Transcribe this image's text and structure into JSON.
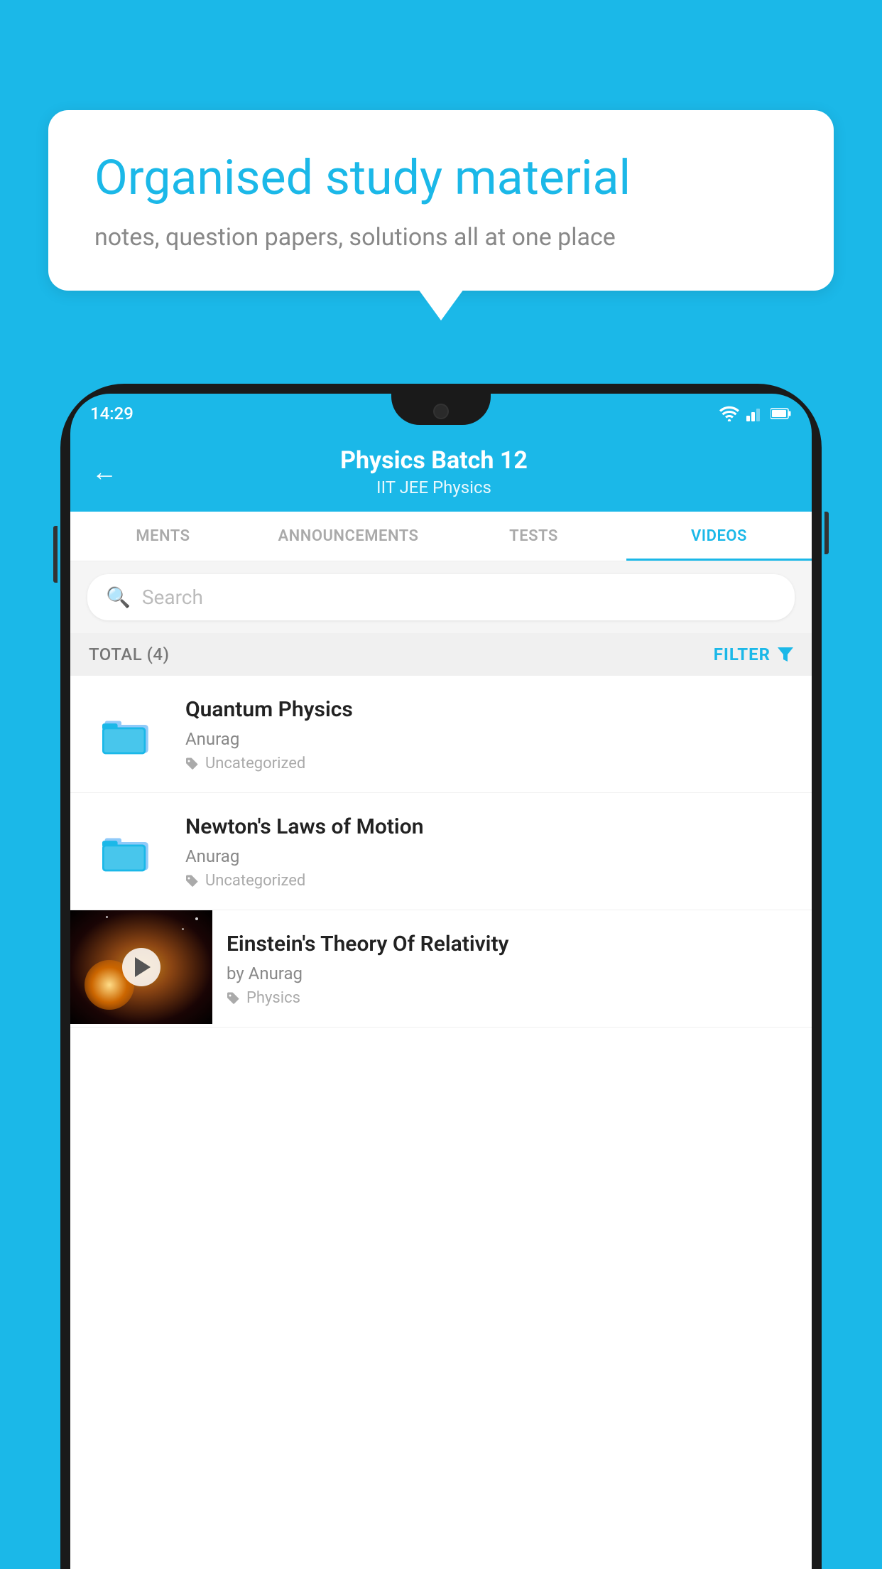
{
  "background_color": "#1BB8E8",
  "speech_bubble": {
    "title": "Organised study material",
    "subtitle": "notes, question papers, solutions all at one place"
  },
  "phone": {
    "status_bar": {
      "time": "14:29"
    },
    "header": {
      "title": "Physics Batch 12",
      "subtitle": "IIT JEE   Physics",
      "back_label": "←"
    },
    "tabs": [
      {
        "label": "MENTS",
        "active": false
      },
      {
        "label": "ANNOUNCEMENTS",
        "active": false
      },
      {
        "label": "TESTS",
        "active": false
      },
      {
        "label": "VIDEOS",
        "active": true
      }
    ],
    "search": {
      "placeholder": "Search"
    },
    "filter": {
      "total_label": "TOTAL (4)",
      "filter_label": "FILTER"
    },
    "videos": [
      {
        "id": "v1",
        "title": "Quantum Physics",
        "author": "Anurag",
        "tag": "Uncategorized",
        "type": "folder",
        "has_thumb": false
      },
      {
        "id": "v2",
        "title": "Newton's Laws of Motion",
        "author": "Anurag",
        "tag": "Uncategorized",
        "type": "folder",
        "has_thumb": false
      },
      {
        "id": "v3",
        "title": "Einstein's Theory Of Relativity",
        "author": "by Anurag",
        "tag": "Physics",
        "type": "video",
        "has_thumb": true
      }
    ]
  }
}
